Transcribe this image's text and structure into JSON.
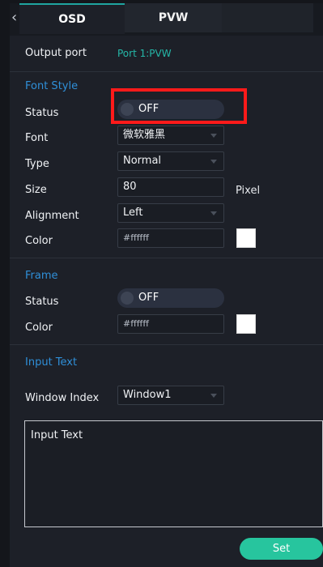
{
  "tabs": {
    "osd": "OSD",
    "pvw": "PVW"
  },
  "output_port": {
    "label": "Output port",
    "value": "Port 1:PVW"
  },
  "font_style": {
    "title": "Font Style",
    "status": {
      "label": "Status",
      "value": "OFF"
    },
    "font": {
      "label": "Font",
      "value": "微软雅黑"
    },
    "type": {
      "label": "Type",
      "value": "Normal"
    },
    "size": {
      "label": "Size",
      "value": "80",
      "unit": "Pixel"
    },
    "alignment": {
      "label": "Alignment",
      "value": "Left"
    },
    "color": {
      "label": "Color",
      "value": "#ffffff",
      "swatch": "#ffffff"
    }
  },
  "frame": {
    "title": "Frame",
    "status": {
      "label": "Status",
      "value": "OFF"
    },
    "color": {
      "label": "Color",
      "value": "#ffffff",
      "swatch": "#ffffff"
    }
  },
  "input_text_section": {
    "title": "Input Text",
    "window_index": {
      "label": "Window Index",
      "value": "Window1"
    },
    "textarea_text": "Input Text"
  },
  "set_button": "Set",
  "colors": {
    "accent_teal": "#25b7a8",
    "section_blue": "#2f8fd8",
    "highlight_red": "#ff1a1a",
    "button_green": "#27c59e"
  }
}
